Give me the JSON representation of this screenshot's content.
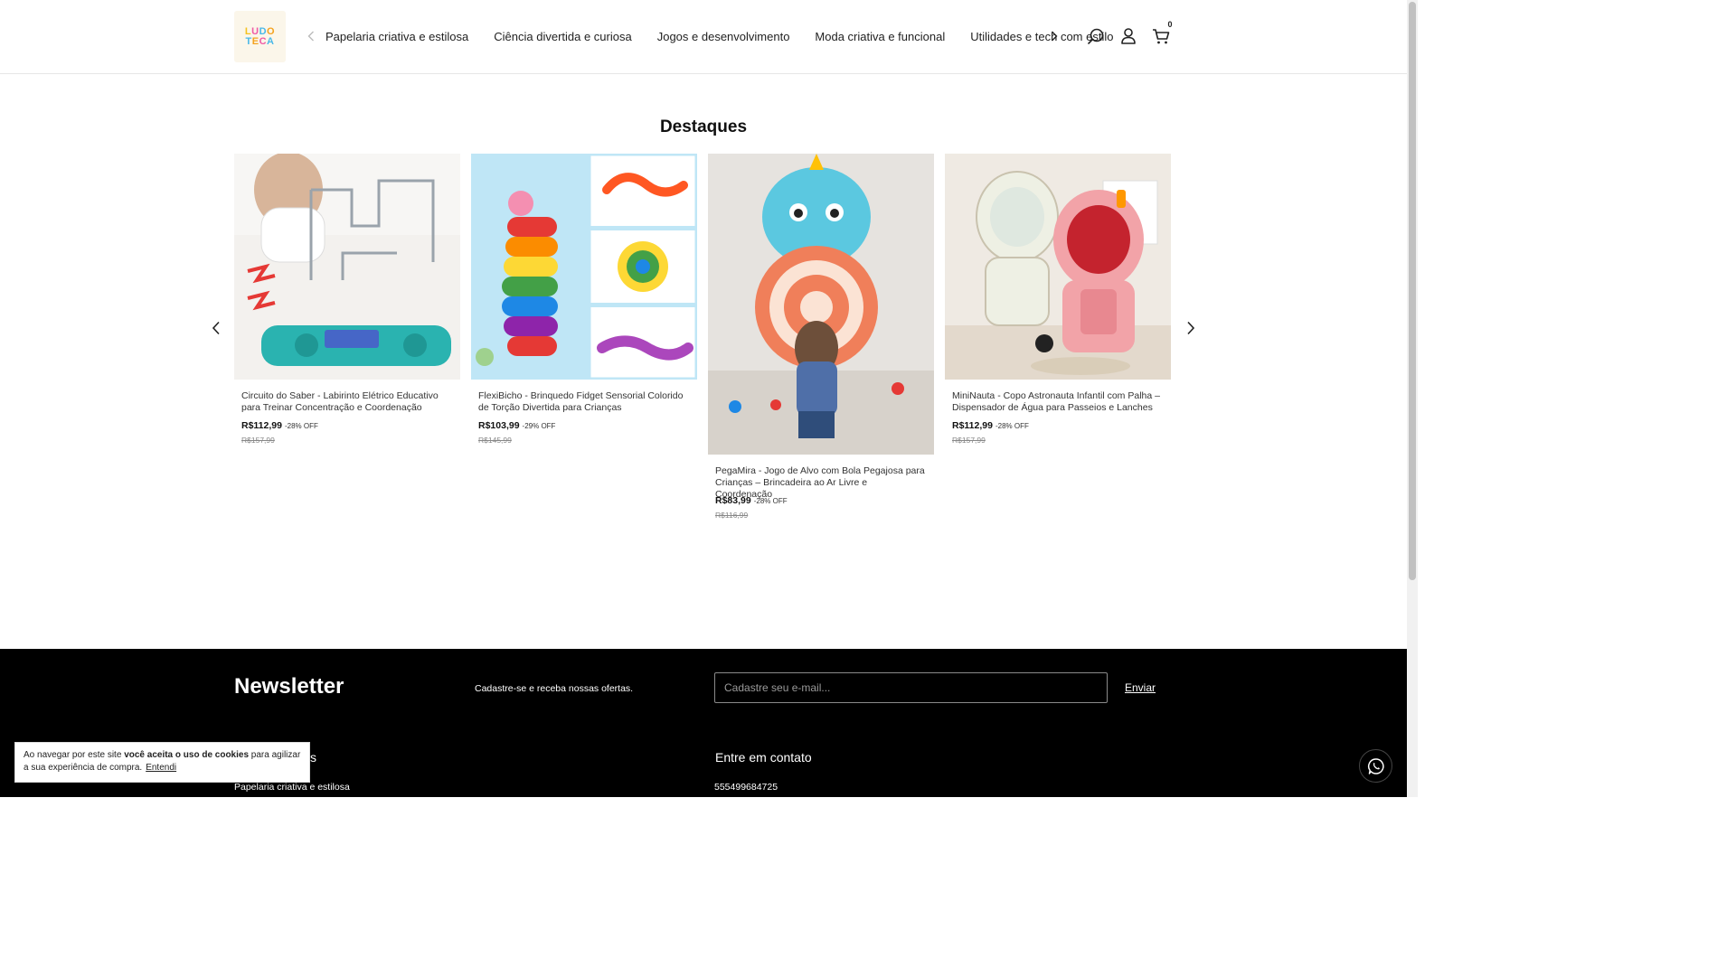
{
  "header": {
    "logo_line1": [
      "L",
      "U",
      "D",
      "O"
    ],
    "logo_line2": [
      "T",
      "E",
      "C",
      "A"
    ],
    "logo_colors": [
      "#f4c21f",
      "#ef5aa5",
      "#4ab8e8",
      "#f4a21f"
    ],
    "nav_items": [
      "Papelaria criativa e estilosa",
      "Ciência divertida e curiosa",
      "Jogos e desenvolvimento",
      "Moda criativa e funcional",
      "Utilidades e tech com estilo"
    ],
    "cart_count": "0"
  },
  "highlights": {
    "title": "Destaques",
    "products": [
      {
        "name": "Circuito do Saber - Labirinto Elétrico Educativo para Treinar Concentração e Coordenação",
        "price": "R$112,99",
        "discount": "-28% OFF",
        "old_price": "R$157,99"
      },
      {
        "name": "FlexiBicho - Brinquedo Fidget Sensorial Colorido de Torção Divertida para Crianças",
        "price": "R$103,99",
        "discount": "-29% OFF",
        "old_price": "R$145,99"
      },
      {
        "name": "PegaMira - Jogo de Alvo com Bola Pegajosa para Crianças – Brincadeira ao Ar Livre e Coordenação",
        "price": "R$83,99",
        "discount": "-28% OFF",
        "old_price": "R$116,99"
      },
      {
        "name": "MiniNauta - Copo Astronauta Infantil com Palha – Dispensador de Água para Passeios e Lanches",
        "price": "R$112,99",
        "discount": "-28% OFF",
        "old_price": "R$157,99"
      }
    ]
  },
  "footer": {
    "newsletter_title": "Newsletter",
    "newsletter_sub": "Cadastre-se e receba nossas ofertas.",
    "email_placeholder": "Cadastre seu e-mail...",
    "send_label": "Enviar",
    "categories_title_visible": "s",
    "categories_first": "Papelaria criativa e estilosa",
    "contact_title": "Entre em contato",
    "phone": "555499684725"
  },
  "cookie": {
    "text_before": "Ao navegar por este site ",
    "text_bold": "você aceita o uso de cookies",
    "text_after": " para agilizar a sua experiência de compra.",
    "accept_label": "Entendi"
  }
}
